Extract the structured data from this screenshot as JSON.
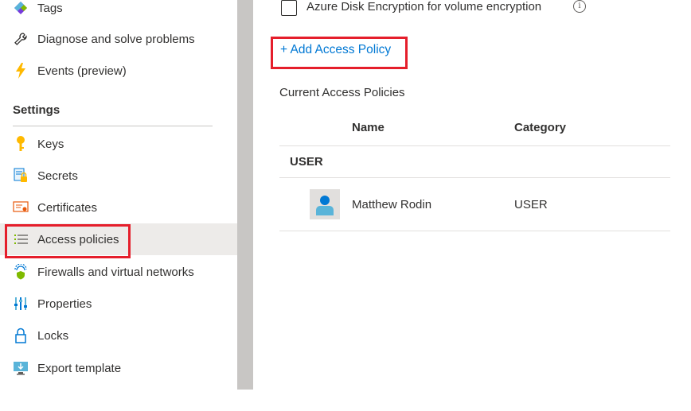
{
  "sidebar": {
    "items_top": [
      {
        "label": "Tags",
        "icon": "tag-icon"
      },
      {
        "label": "Diagnose and solve problems",
        "icon": "wrench-icon"
      },
      {
        "label": "Events (preview)",
        "icon": "lightning-icon"
      }
    ],
    "settings_header": "Settings",
    "settings_items": [
      {
        "label": "Keys",
        "icon": "key-icon"
      },
      {
        "label": "Secrets",
        "icon": "secret-icon"
      },
      {
        "label": "Certificates",
        "icon": "certificate-icon"
      },
      {
        "label": "Access policies",
        "icon": "access-policies-icon"
      },
      {
        "label": "Firewalls and virtual networks",
        "icon": "network-icon"
      },
      {
        "label": "Properties",
        "icon": "properties-icon"
      },
      {
        "label": "Locks",
        "icon": "lock-icon"
      },
      {
        "label": "Export template",
        "icon": "export-template-icon"
      }
    ],
    "selected": "Access policies"
  },
  "main": {
    "disk_encryption_label": "Azure Disk Encryption for volume encryption",
    "disk_encryption_checked": false,
    "add_policy_link": "+ Add Access Policy",
    "current_policies_title": "Current Access Policies",
    "table": {
      "columns": [
        "Name",
        "Category"
      ],
      "groups": [
        {
          "label": "USER",
          "rows": [
            {
              "name": "Matthew Rodin",
              "category": "USER",
              "icon": "user-avatar-icon"
            }
          ]
        }
      ]
    }
  },
  "colors": {
    "accent": "#0078d4",
    "highlight": "#e51e2b",
    "selected_bg": "#edebe9",
    "splitter": "#c8c6c4"
  }
}
